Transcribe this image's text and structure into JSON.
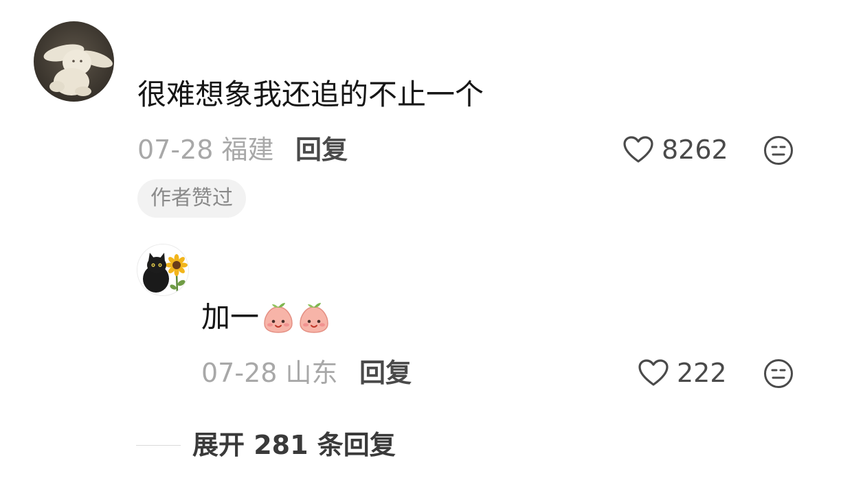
{
  "comment": {
    "avatar_icon": "plush-bunny-avatar",
    "text": "很难想象我还追的不止一个",
    "date": "07-28",
    "location": "福建",
    "reply_label": "回复",
    "likes": "8262",
    "badge": "作者赞过"
  },
  "reply": {
    "avatar_icon": "black-cat-sunflower-avatar",
    "text": "加一",
    "emojis": [
      "peach-smile-emoji",
      "peach-smile-emoji"
    ],
    "date": "07-28",
    "location": "山东",
    "reply_label": "回复",
    "likes": "222"
  },
  "expand": {
    "label": "展开 281 条回复"
  },
  "colors": {
    "text": "#161616",
    "meta": "#a8a8a8",
    "action": "#4a4a4a",
    "badge_bg": "#f2f2f2"
  }
}
